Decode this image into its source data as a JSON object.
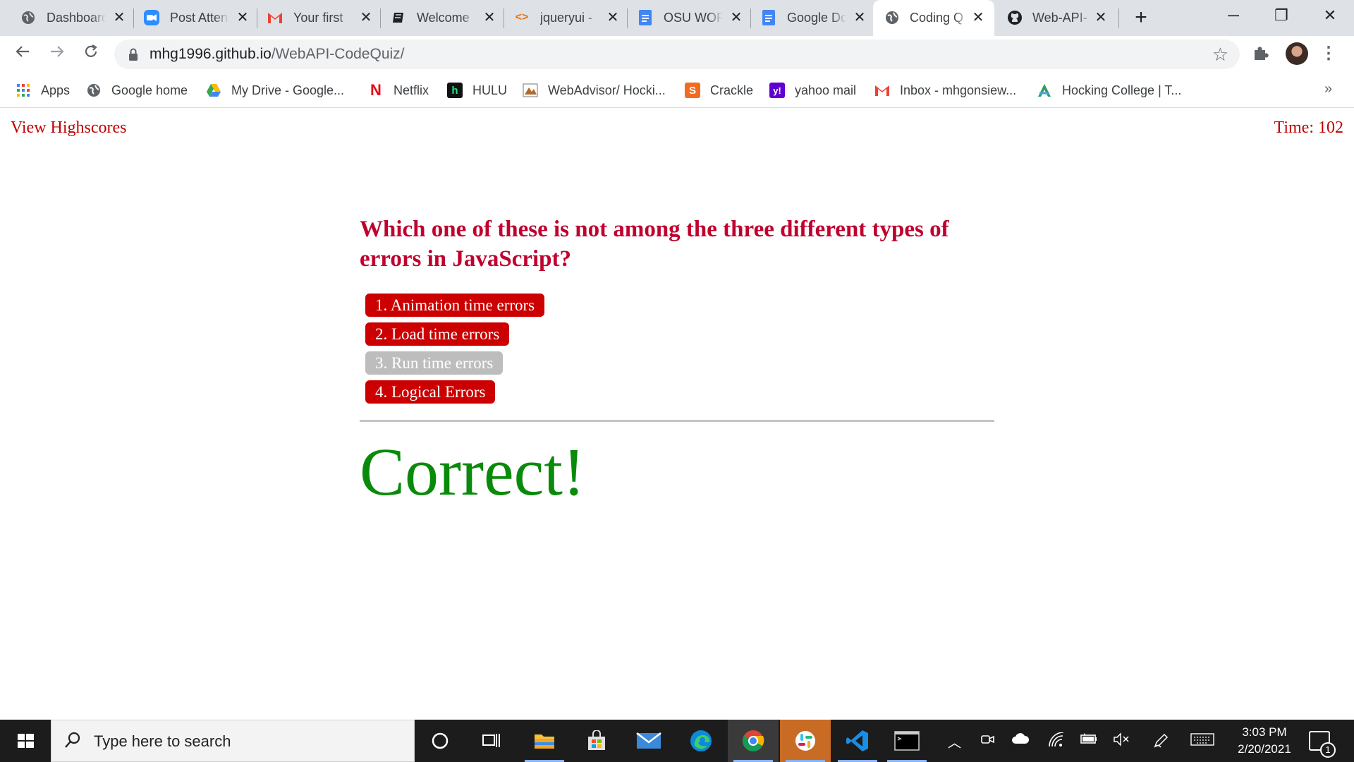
{
  "browser": {
    "tabs": [
      {
        "title": "Dashboard",
        "icon": "globe-icon"
      },
      {
        "title": "Post Attendance",
        "icon": "zoom-icon"
      },
      {
        "title": "Your first",
        "icon": "gmail-icon"
      },
      {
        "title": "Welcome",
        "icon": "notebook-icon"
      },
      {
        "title": "jqueryui -",
        "icon": "code-icon"
      },
      {
        "title": "OSU WOF",
        "icon": "docs-icon"
      },
      {
        "title": "Google Do",
        "icon": "docs-icon"
      },
      {
        "title": "Coding Q",
        "icon": "globe-icon",
        "active": true
      },
      {
        "title": "Web-API-",
        "icon": "github-icon"
      }
    ],
    "address": {
      "host": "mhg1996.github.io",
      "path": "/WebAPI-CodeQuiz/"
    },
    "bookmarks": [
      {
        "label": "Apps",
        "icon": "apps-grid-icon"
      },
      {
        "label": "Google home",
        "icon": "globe-icon"
      },
      {
        "label": "My Drive - Google...",
        "icon": "drive-icon"
      },
      {
        "label": "Netflix",
        "icon": "netflix-icon"
      },
      {
        "label": "HULU",
        "icon": "hulu-icon"
      },
      {
        "label": "WebAdvisor/ Hocki...",
        "icon": "webadvisor-icon"
      },
      {
        "label": "Crackle",
        "icon": "crackle-icon"
      },
      {
        "label": "yahoo mail",
        "icon": "yahoo-icon"
      },
      {
        "label": "Inbox - mhgonsiew...",
        "icon": "gmail-icon"
      },
      {
        "label": "Hocking College | T...",
        "icon": "hocking-icon"
      }
    ],
    "more_bookmarks": "»"
  },
  "page": {
    "highscores_link": "View Highscores",
    "timer": "Time: 102",
    "question": "Which one of these is not among the three different types of errors in JavaScript?",
    "choices": [
      {
        "label": "1. Animation time errors",
        "dimmed": false
      },
      {
        "label": "2. Load time errors",
        "dimmed": false
      },
      {
        "label": "3. Run time errors",
        "dimmed": true
      },
      {
        "label": "4. Logical Errors",
        "dimmed": false
      }
    ],
    "result": "Correct!"
  },
  "colors": {
    "question": "#c0002e",
    "choice_bg": "#cc0000",
    "choice_dim_bg": "#bdbdbd",
    "result": "#0a8a0a",
    "link": "#c00000"
  },
  "taskbar": {
    "search_placeholder": "Type here to search",
    "time": "3:03 PM",
    "date": "2/20/2021",
    "notification_count": "1",
    "apps": [
      "cortana-icon",
      "task-view-icon",
      "file-explorer-icon",
      "store-icon",
      "mail-icon",
      "edge-icon",
      "chrome-icon",
      "slack-icon",
      "vscode-icon",
      "terminal-icon"
    ]
  }
}
